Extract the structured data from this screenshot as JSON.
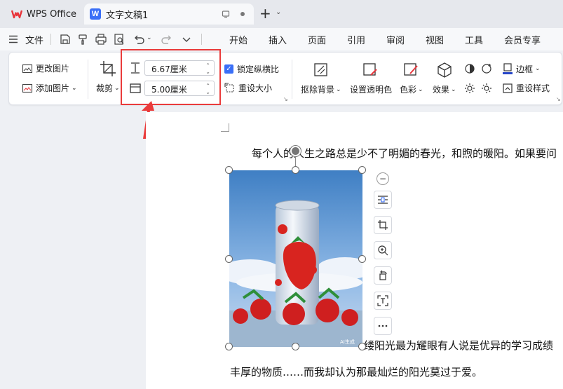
{
  "tabs": {
    "wps_label": "WPS Office",
    "doc_label": "文字文稿1",
    "doc_logo_letter": "W"
  },
  "menubar": {
    "file_label": "文件",
    "items": [
      "开始",
      "插入",
      "页面",
      "引用",
      "审阅",
      "视图",
      "工具",
      "会员专享"
    ]
  },
  "ribbon": {
    "change_picture": "更改图片",
    "add_picture": "添加图片",
    "crop": "裁剪",
    "height_value": "6.67厘米",
    "width_value": "5.00厘米",
    "lock_ratio": "锁定纵横比",
    "reset_size": "重设大小",
    "remove_bg": "抠除背景",
    "set_transparent": "设置透明色",
    "color": "色彩",
    "effects": "效果",
    "border": "边框",
    "reset_style": "重设样式"
  },
  "document": {
    "para1": "每个人的人生之路总是少不了明媚的春光，和煦的暖阳。如果要问",
    "para2": "缕阳光最为耀眼有人说是优异的学习成绩",
    "para3": "丰厚的物质……而我却认为那最灿烂的阳光莫过于爱。",
    "watermark": "AI生成"
  },
  "colors": {
    "accent": "#3a6ff7",
    "highlight": "#ea3b3b",
    "wps_red": "#e8343a"
  }
}
